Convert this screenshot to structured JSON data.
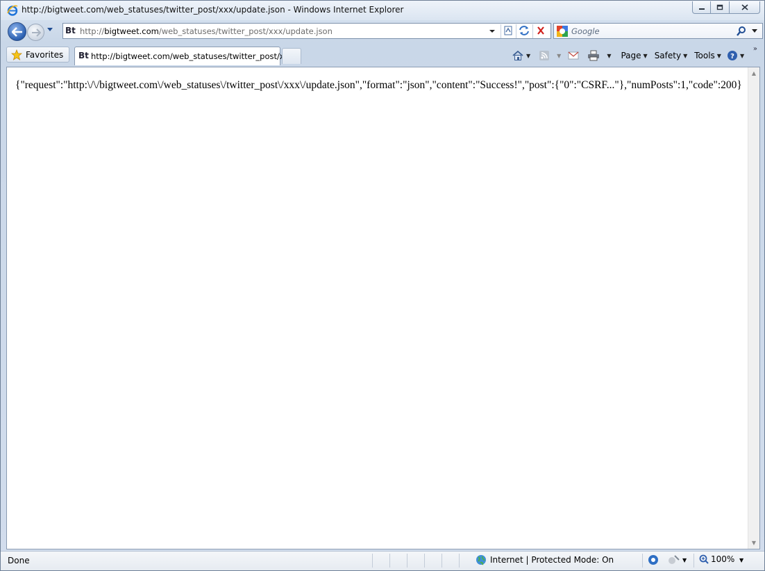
{
  "window": {
    "title": "http://bigtweet.com/web_statuses/twitter_post/xxx/update.json - Windows Internet Explorer"
  },
  "address_bar": {
    "url_prefix": "http://",
    "url_domain": "bigtweet.com",
    "url_path": "/web_statuses/twitter_post/xxx/update.json"
  },
  "search": {
    "placeholder": "Google"
  },
  "favorites": {
    "label": "Favorites"
  },
  "tabs": [
    {
      "label": "http://bigtweet.com/web_statuses/twitter_post/x...",
      "active": true
    }
  ],
  "command_bar": {
    "page_label": "Page",
    "safety_label": "Safety",
    "tools_label": "Tools"
  },
  "page": {
    "body_text": "{\"request\":\"http:\\/\\/bigtweet.com\\/web_statuses\\/twitter_post\\/xxx\\/update.json\",\"format\":\"json\",\"content\":\"Success!\",\"post\":{\"0\":\"CSRF...\"},\"numPosts\":1,\"code\":200}"
  },
  "status_bar": {
    "status": "Done",
    "zone": "Internet | Protected Mode: On",
    "zoom": "100%"
  },
  "colors": {
    "chrome_blue": "#c9d7e8",
    "back_button": "#2a5fb0",
    "stop_red": "#d0201c"
  }
}
